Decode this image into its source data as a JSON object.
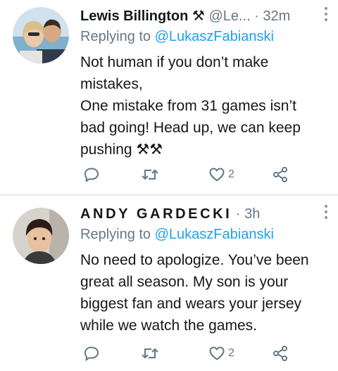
{
  "tweets": [
    {
      "author_name": "Lewis Billington",
      "author_badge": "⚒",
      "handle": "@Le...",
      "separator": "·",
      "time": "32m",
      "reply_prefix": "Replying to ",
      "reply_mention": "@LukaszFabianski",
      "body_lines": [
        "Not human if you don’t make",
        "mistakes,",
        "One mistake from 31 games isn’t",
        "bad going! Head up, we can keep",
        "pushing ⚒⚒"
      ],
      "like_count": "2"
    },
    {
      "author_name": "ANDY GARDECKI",
      "handle": "",
      "separator": "·",
      "time": "3h",
      "reply_prefix": "Replying to ",
      "reply_mention": "@LukaszFabianski",
      "body_lines": [
        "No need to apologize. You’ve been",
        "great all season. My son is your",
        "biggest fan and wears your jersey",
        "while we watch the games."
      ],
      "like_count": "2"
    }
  ],
  "icons": {
    "reply": "reply-icon",
    "retweet": "retweet-icon",
    "like": "heart-icon",
    "share": "share-icon",
    "more": "more-vertical-icon"
  },
  "colors": {
    "accent": "#1da1f2",
    "muted": "#657786",
    "text": "#14171a",
    "divider": "#e6ecf0"
  }
}
